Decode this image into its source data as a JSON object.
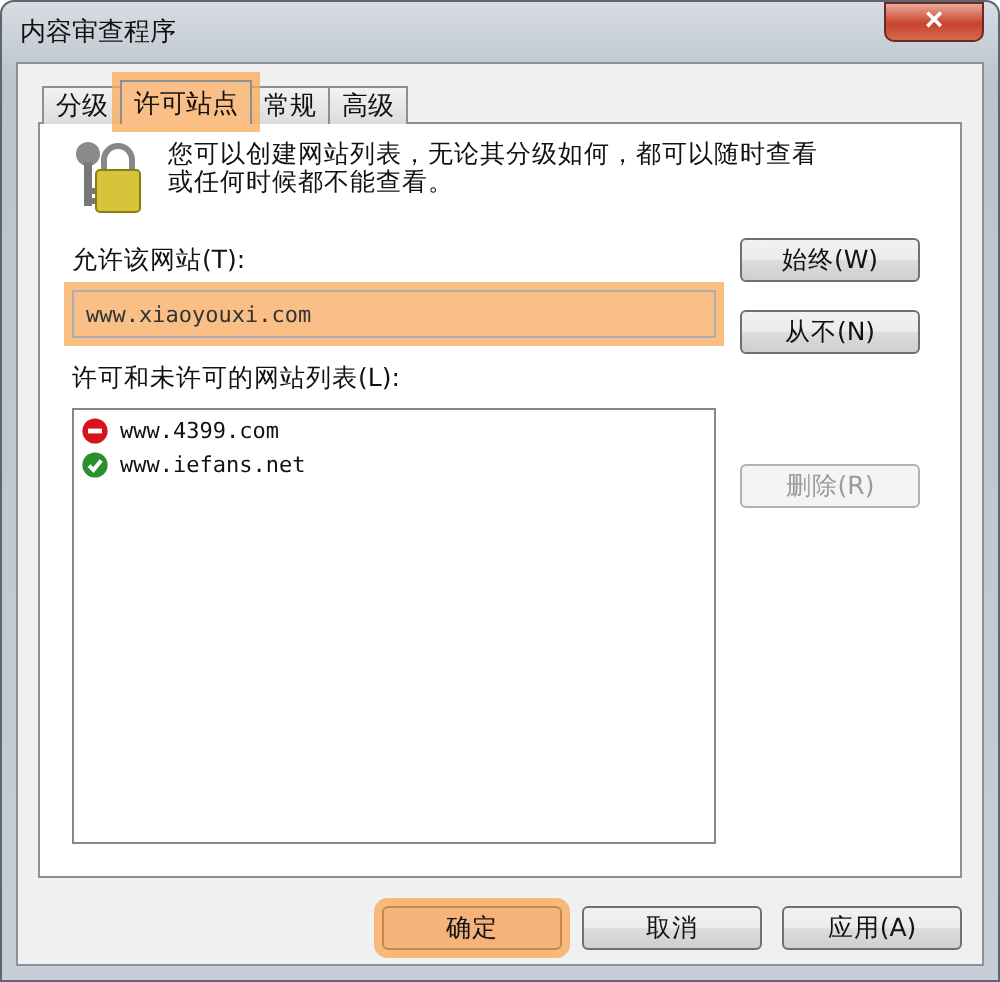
{
  "window": {
    "title": "内容审查程序",
    "close": "×"
  },
  "tabs": [
    {
      "label": "分级",
      "selected": false,
      "highlighted": false
    },
    {
      "label": "许可站点",
      "selected": true,
      "highlighted": true
    },
    {
      "label": "常规",
      "selected": false,
      "highlighted": false
    },
    {
      "label": "高级",
      "selected": false,
      "highlighted": false
    }
  ],
  "intro": "您可以创建网站列表，无论其分级如何，都可以随时查看或任何时候都不能查看。",
  "site_field": {
    "label": "允许该网站(T):",
    "value": "www.xiaoyouxi.com",
    "highlighted": true
  },
  "side_buttons": [
    {
      "label": "始终(W)",
      "disabled": false
    },
    {
      "label": "从不(N)",
      "disabled": false
    },
    {
      "label": "删除(R)",
      "disabled": true
    }
  ],
  "list_label": "许可和未许可的网站列表(L):",
  "sites": [
    {
      "name": "www.4399.com",
      "kind": "blocked"
    },
    {
      "name": "www.iefans.net",
      "kind": "allowed"
    }
  ],
  "footer_buttons": [
    {
      "label": "确定",
      "highlighted": true
    },
    {
      "label": "取消",
      "highlighted": false
    },
    {
      "label": "应用(A)",
      "highlighted": false
    }
  ]
}
